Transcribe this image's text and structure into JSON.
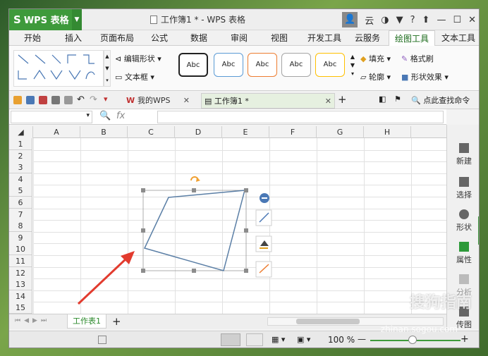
{
  "app": {
    "name": "WPS 表格",
    "doc_title": "工作簿1 * - WPS 表格",
    "user_initial": "云"
  },
  "menu": {
    "tabs": [
      "开始",
      "插入",
      "页面布局",
      "公式",
      "数据",
      "审阅",
      "视图",
      "开发工具",
      "云服务",
      "绘图工具",
      "文本工具"
    ],
    "active": "绘图工具"
  },
  "ribbon": {
    "edit_shape": "编辑形状",
    "textbox": "文本框",
    "style_label": "Abc",
    "fill": "填充",
    "format_painter": "格式刷",
    "outline": "轮廓",
    "shape_effect": "形状效果",
    "style_colors": [
      "#222222",
      "#5b9bd5",
      "#ed7d31",
      "#a5a5a5",
      "#ffc000"
    ]
  },
  "quickbar": {
    "mywps": "我的WPS",
    "doc_tab": "工作簿1 *",
    "search": "点此查找命令"
  },
  "formula": {
    "fx": "fx"
  },
  "columns": [
    "A",
    "B",
    "C",
    "D",
    "E",
    "F",
    "G",
    "H"
  ],
  "rows": [
    "1",
    "2",
    "3",
    "4",
    "5",
    "6",
    "7",
    "8",
    "9",
    "10",
    "11",
    "12",
    "13",
    "14",
    "15"
  ],
  "right_panel": {
    "items": [
      "新建",
      "选择",
      "形状",
      "属性",
      "分析",
      "传图"
    ]
  },
  "sheet": {
    "tab": "工作表1"
  },
  "status": {
    "zoom": "100 %"
  },
  "watermark": {
    "text": "搜狗指南",
    "url": "zhinan.sogou.com"
  },
  "colors": {
    "accent": "#3e9a3b",
    "shape_stroke": "#5b7fa6",
    "arrow": "#e23b2e",
    "handle": "#888888",
    "rotate": "#f0a030"
  }
}
